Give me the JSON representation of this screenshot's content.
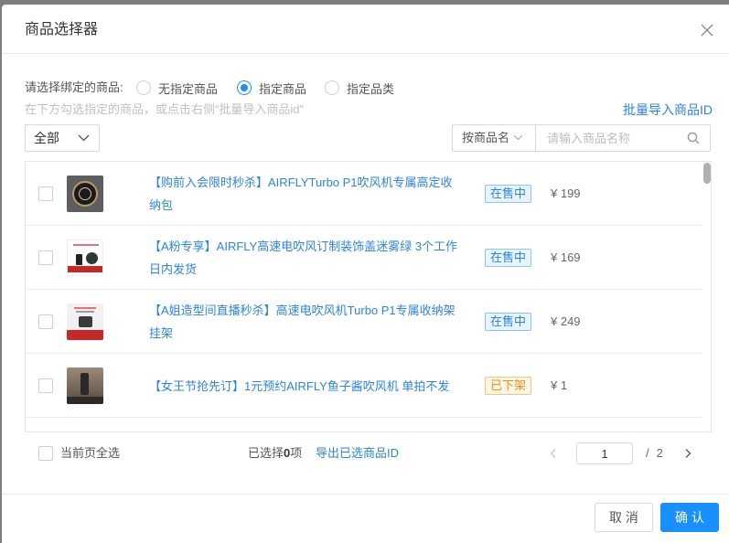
{
  "dialog": {
    "title": "商品选择器"
  },
  "binding": {
    "label": "请选择绑定的商品:",
    "options": [
      {
        "label": "无指定商品",
        "checked": false
      },
      {
        "label": "指定商品",
        "checked": true
      },
      {
        "label": "指定品类",
        "checked": false
      }
    ]
  },
  "hint": "在下方勾选指定的商品，或点击右侧“批量导入商品id”",
  "batch_import_link": "批量导入商品ID",
  "filters": {
    "status": "全部",
    "search_field": "按商品名",
    "search_placeholder": "请输入商品名称"
  },
  "products": [
    {
      "selected": false,
      "title": "【购前入会限时秒杀】AIRFLYTurbo P1吹风机专属高定收纳包",
      "status": "在售中",
      "status_tone": "blue",
      "price": "¥ 199"
    },
    {
      "selected": false,
      "title": "【A粉专享】AIRFLY高速电吹风订制装饰盖迷雾绿 3个工作日内发货",
      "status": "在售中",
      "status_tone": "blue",
      "price": "¥ 169"
    },
    {
      "selected": false,
      "title": "【A姐造型间直播秒杀】高速电吹风机Turbo P1专属收纳架挂架",
      "status": "在售中",
      "status_tone": "blue",
      "price": "¥ 249"
    },
    {
      "selected": false,
      "title": "【女王节抢先订】1元预约AIRFLY鱼子酱吹风机 单拍不发",
      "status": "已下架",
      "status_tone": "orange",
      "price": "¥ 1"
    }
  ],
  "footer": {
    "select_page_label": "当前页全选",
    "select_page_checked": false,
    "selected_prefix": "已选择",
    "selected_count": 0,
    "selected_suffix": "项",
    "export_link": "导出已选商品ID"
  },
  "pagination": {
    "current": 1,
    "separator": "/",
    "total": 2
  },
  "actions": {
    "cancel": "取 消",
    "confirm": "确 认"
  },
  "icons": {
    "close": "close-icon",
    "dropdown": "chevron-down-icon",
    "search": "search-icon",
    "prev": "chevron-left-icon",
    "next": "chevron-right-icon"
  },
  "colors": {
    "primary": "#1890ff",
    "link": "#2b84e0",
    "blue": "#2b84e0",
    "orange": "#fa8c16"
  }
}
